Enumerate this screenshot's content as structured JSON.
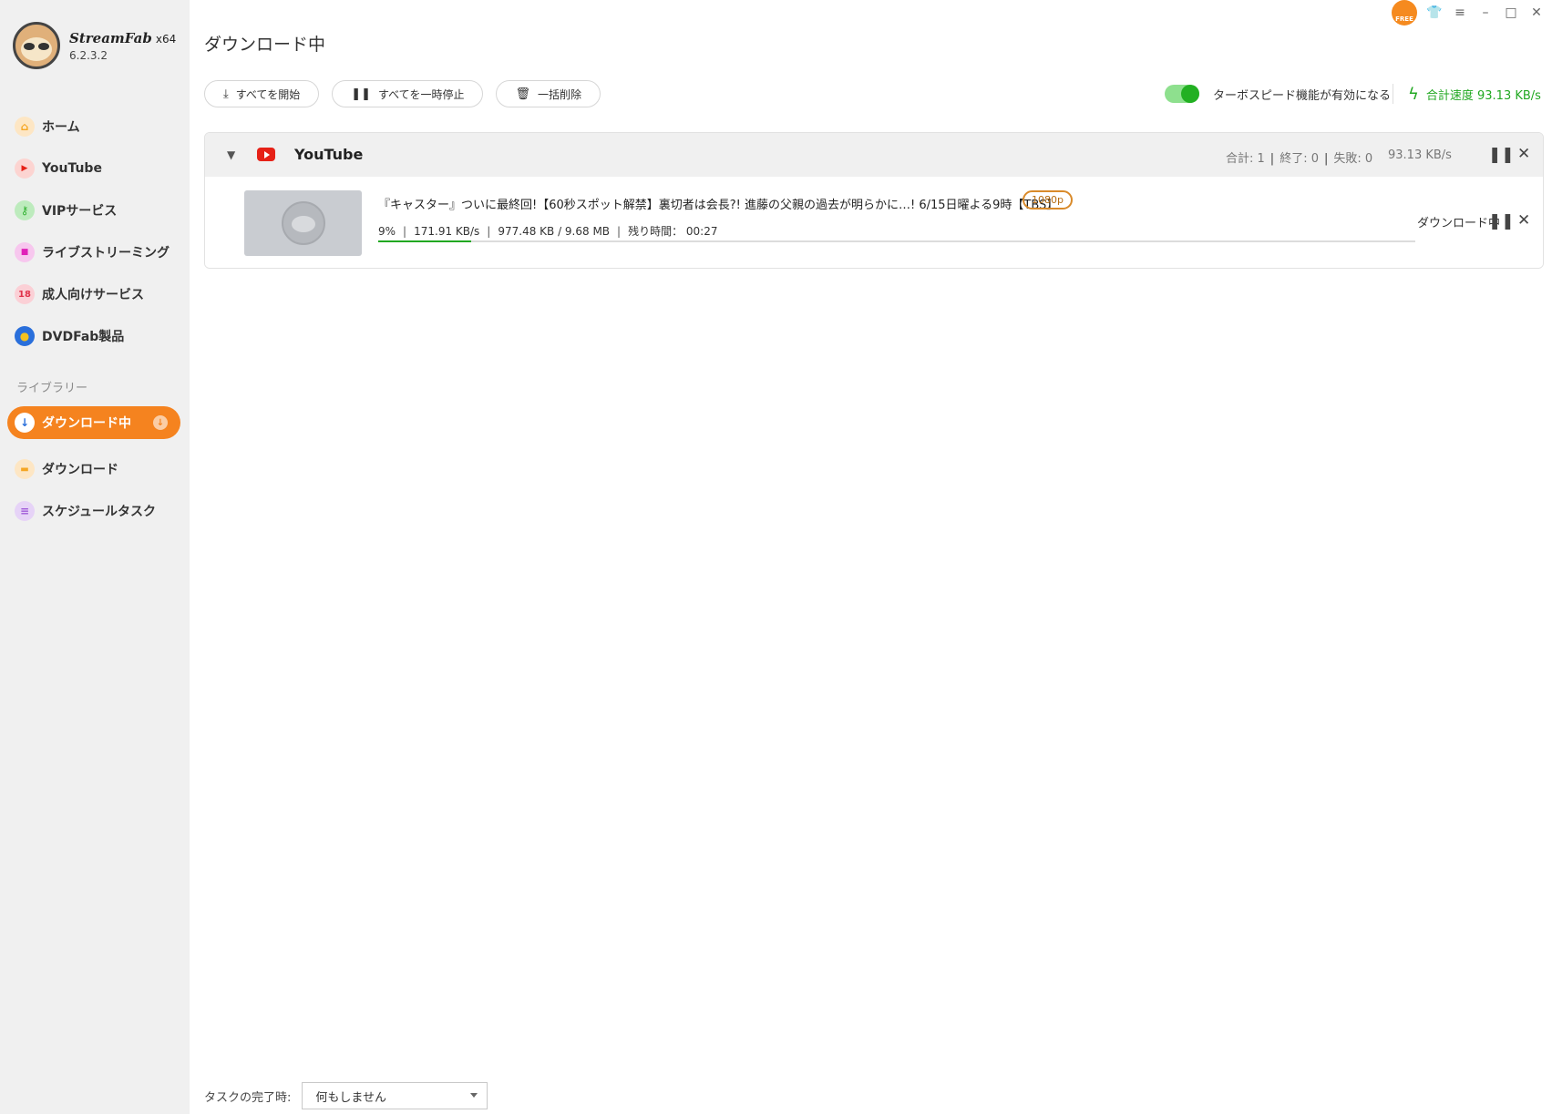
{
  "app": {
    "name": "StreamFab",
    "arch": "x64",
    "version": "6.2.3.2",
    "free_badge": "FREE"
  },
  "sidebar": {
    "items": [
      {
        "label": "ホーム",
        "icon": "home-icon",
        "color": "#f5a623",
        "glyph": "⌂"
      },
      {
        "label": "YouTube",
        "icon": "youtube-icon",
        "color": "#e62117",
        "glyph": "▶"
      },
      {
        "label": "VIPサービス",
        "icon": "key-icon",
        "color": "#2fb12f",
        "glyph": "⚷"
      },
      {
        "label": "ライブストリーミング",
        "icon": "camera-icon",
        "color": "#e020b8",
        "glyph": "■"
      },
      {
        "label": "成人向けサービス",
        "icon": "adult-icon",
        "color": "#e0334b",
        "glyph": "18"
      },
      {
        "label": "DVDFab製品",
        "icon": "dvdfab-icon",
        "color": "#2a6fdb",
        "glyph": "●"
      }
    ],
    "library_title": "ライブラリー",
    "library": [
      {
        "label": "ダウンロード中",
        "icon": "download-icon",
        "glyph": "↓",
        "badge": "↓"
      },
      {
        "label": "ダウンロード",
        "icon": "folder-icon",
        "color": "#f5a623",
        "glyph": "▬"
      },
      {
        "label": "スケジュールタスク",
        "icon": "schedule-icon",
        "color": "#a05ad8",
        "glyph": "≡"
      }
    ]
  },
  "main": {
    "title": "ダウンロード中",
    "toolbar": {
      "start_all": "すべてを開始",
      "pause_all": "すべてを一時停止",
      "delete_all": "一括削除"
    },
    "turbo_label": "ターボスピード機能が有効になる",
    "turbo_enabled": true,
    "total_speed": "合計速度 93.13 KB/s",
    "accent_color": "#21a821"
  },
  "group": {
    "name": "YouTube",
    "total": "合計: 1",
    "done": "終了: 0",
    "failed": "失敗: 0",
    "speed": "93.13 KB/s",
    "items": [
      {
        "title": "『キャスター』ついに最終回!【60秒スポット解禁】裏切者は会長?! 進藤の父親の過去が明らかに…! 6/15日曜よる9時【TBS】",
        "resolution": "1080p",
        "percent": "9%",
        "speed": "171.91 KB/s",
        "size": "977.48 KB / 9.68 MB",
        "remaining": "残り時間： 00:27",
        "progress": 0.09,
        "status": "ダウンロード中"
      }
    ]
  },
  "footer": {
    "label": "タスクの完了時:",
    "select_value": "何もしません"
  }
}
